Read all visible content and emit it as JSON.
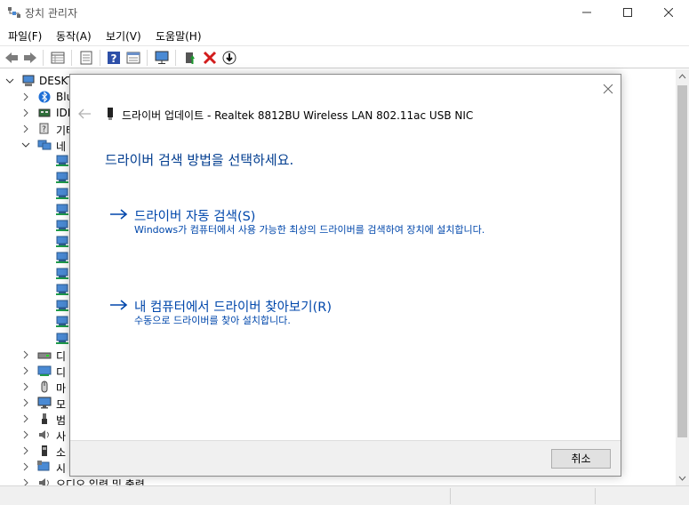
{
  "window": {
    "title": "장치 관리자",
    "minimize_icon": "minimize-icon",
    "maximize_icon": "maximize-icon",
    "close_icon": "close-icon"
  },
  "menu": [
    "파일(F)",
    "동작(A)",
    "보기(V)",
    "도움말(H)"
  ],
  "toolbar": {
    "icons": [
      "back-icon",
      "forward-icon",
      "properties-grid-icon",
      "document-icon",
      "help-icon",
      "panel-icon",
      "monitor-icon",
      "update-driver-icon",
      "uninstall-x-icon",
      "download-circle-icon"
    ]
  },
  "tree": {
    "root_label": "DESKT",
    "children": [
      {
        "label": "Blu",
        "icon": "bluetooth-icon"
      },
      {
        "label": "IDE",
        "icon": "ide-controller-icon"
      },
      {
        "label": "기타",
        "icon": "unknown-device-icon"
      },
      {
        "label": "네",
        "icon": "network-icon"
      },
      {
        "label": "",
        "icon": "network-adapter-icon"
      },
      {
        "label": "",
        "icon": "network-adapter-icon"
      },
      {
        "label": "",
        "icon": "network-adapter-icon"
      },
      {
        "label": "",
        "icon": "network-adapter-icon"
      },
      {
        "label": "",
        "icon": "network-adapter-icon"
      },
      {
        "label": "",
        "icon": "network-adapter-icon"
      },
      {
        "label": "",
        "icon": "network-adapter-icon"
      },
      {
        "label": "",
        "icon": "network-adapter-icon"
      },
      {
        "label": "",
        "icon": "network-adapter-icon"
      },
      {
        "label": "",
        "icon": "network-adapter-icon"
      },
      {
        "label": "",
        "icon": "network-adapter-icon"
      },
      {
        "label": "",
        "icon": "network-adapter-icon"
      },
      {
        "label": "디",
        "icon": "disk-drive-icon"
      },
      {
        "label": "디",
        "icon": "display-adapter-icon"
      },
      {
        "label": "마",
        "icon": "mouse-icon"
      },
      {
        "label": "모",
        "icon": "monitor-icon"
      },
      {
        "label": "범",
        "icon": "usb-icon"
      },
      {
        "label": "사",
        "icon": "audio-icon"
      },
      {
        "label": "소",
        "icon": "software-device-icon"
      },
      {
        "label": "시",
        "icon": "system-device-icon"
      },
      {
        "label": "오디오 입력 및 출력",
        "icon": "audio-io-icon"
      }
    ]
  },
  "dialog": {
    "title": "드라이버 업데이트 - Realtek 8812BU Wireless LAN 802.11ac USB NIC",
    "heading": "드라이버 검색 방법을 선택하세요.",
    "options": [
      {
        "title": "드라이버 자동 검색(S)",
        "description": "Windows가 컴퓨터에서 사용 가능한 최상의 드라이버를 검색하여 장치에 설치합니다."
      },
      {
        "title": "내 컴퓨터에서 드라이버 찾아보기(R)",
        "description": "수동으로 드라이버를 찾아 설치합니다."
      }
    ],
    "cancel_label": "취소"
  },
  "colors": {
    "link_blue": "#0047ab",
    "heading_blue": "#003c8f",
    "footer_bg": "#f0f0f0"
  }
}
